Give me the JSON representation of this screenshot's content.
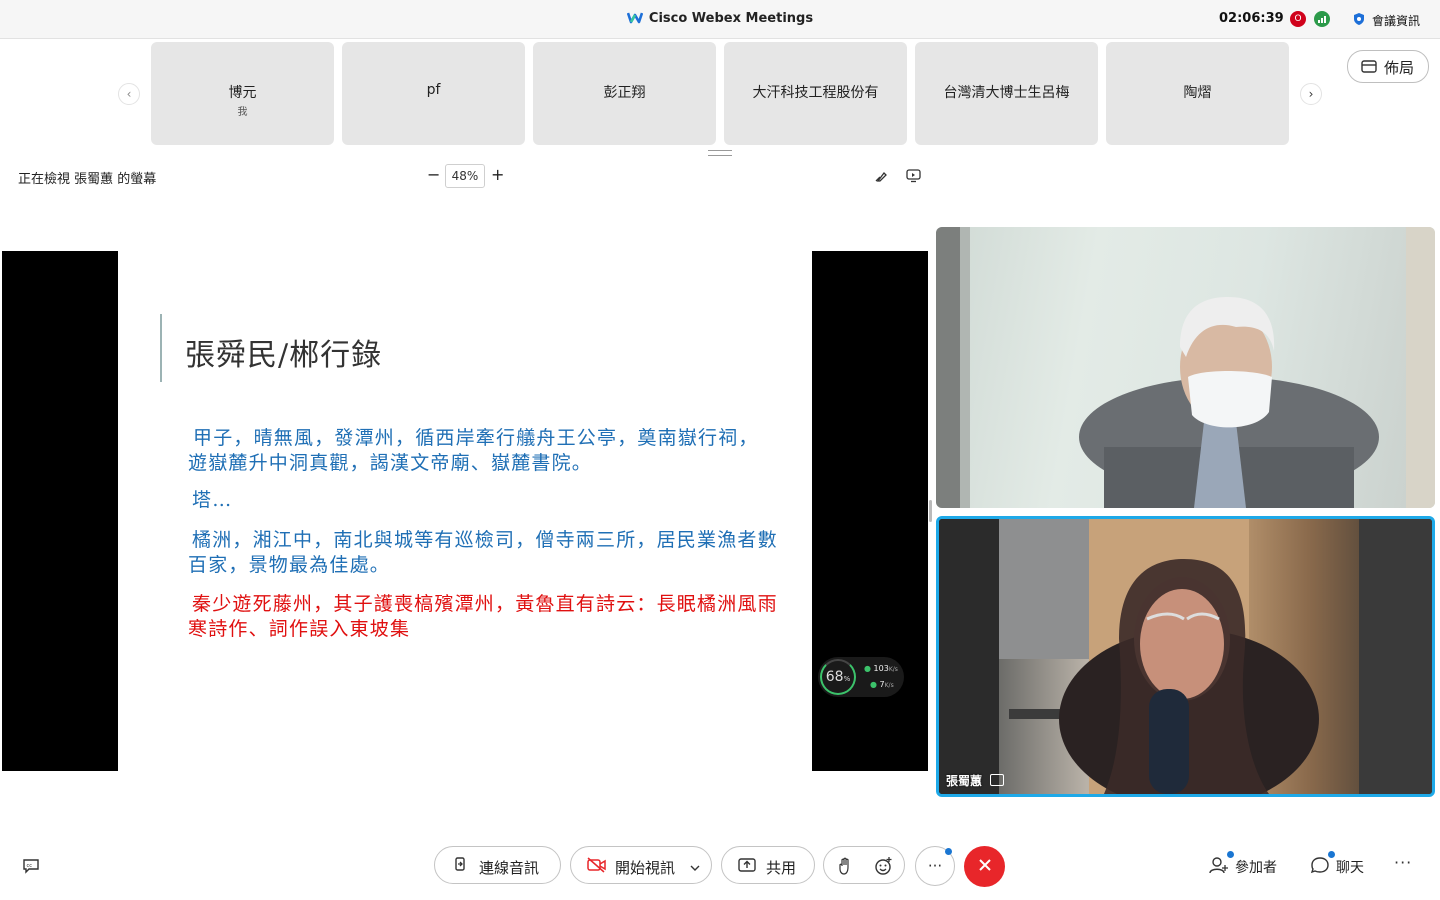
{
  "titlebar": {
    "app_title": "Cisco Webex Meetings",
    "clock": "02:06:39",
    "rec_letter": "O",
    "meeting_info": "會議資訊"
  },
  "participants": [
    {
      "name": "博元",
      "sub": "我"
    },
    {
      "name": "pf",
      "sub": ""
    },
    {
      "name": "彭正翔",
      "sub": ""
    },
    {
      "name": "大汗科技工程股份有",
      "sub": ""
    },
    {
      "name": "台灣清大博士生呂梅",
      "sub": ""
    },
    {
      "name": "陶熠",
      "sub": ""
    }
  ],
  "nav": {
    "prev": "‹",
    "next": "›"
  },
  "layout_label": "佈局",
  "viewing": {
    "label": "正在檢視 張蜀蕙 的螢幕",
    "zoom_out": "−",
    "zoom": "48%",
    "zoom_in": "+"
  },
  "slide": {
    "title": "張舜民/郴行錄",
    "para1": "甲子，晴無風，發潭州，循西岸牽行艤舟王公亭，奠南嶽行祠，遊嶽麓升中洞真觀，謁漢文帝廟、嶽麓書院。",
    "para2": "塔…",
    "para3": "橘洲，湘江中，南北與城等有巡檢司，僧寺兩三所，居民業漁者數百家，景物最為佳處。",
    "para4": "秦少遊死藤州，其子護喪槁殯潭州，黃魯直有詩云：長眠橘洲風雨寒詩作、詞作誤入東坡集"
  },
  "network": {
    "percent": "68",
    "percent_unit": "%",
    "up": "103",
    "up_unit": "K/s",
    "down": "7",
    "down_unit": "K/s"
  },
  "video2_name": "張蜀蕙",
  "toolbar": {
    "audio": "連線音訊",
    "video": "開始視訊",
    "share": "共用",
    "more": "···",
    "participants": "參加者",
    "chat": "聊天",
    "more_right": "···"
  },
  "colors": {
    "accent": "#1ea9e8",
    "end_call": "#e8262a",
    "slide_blue": "#1f6fb5",
    "slide_red": "#e01010"
  }
}
